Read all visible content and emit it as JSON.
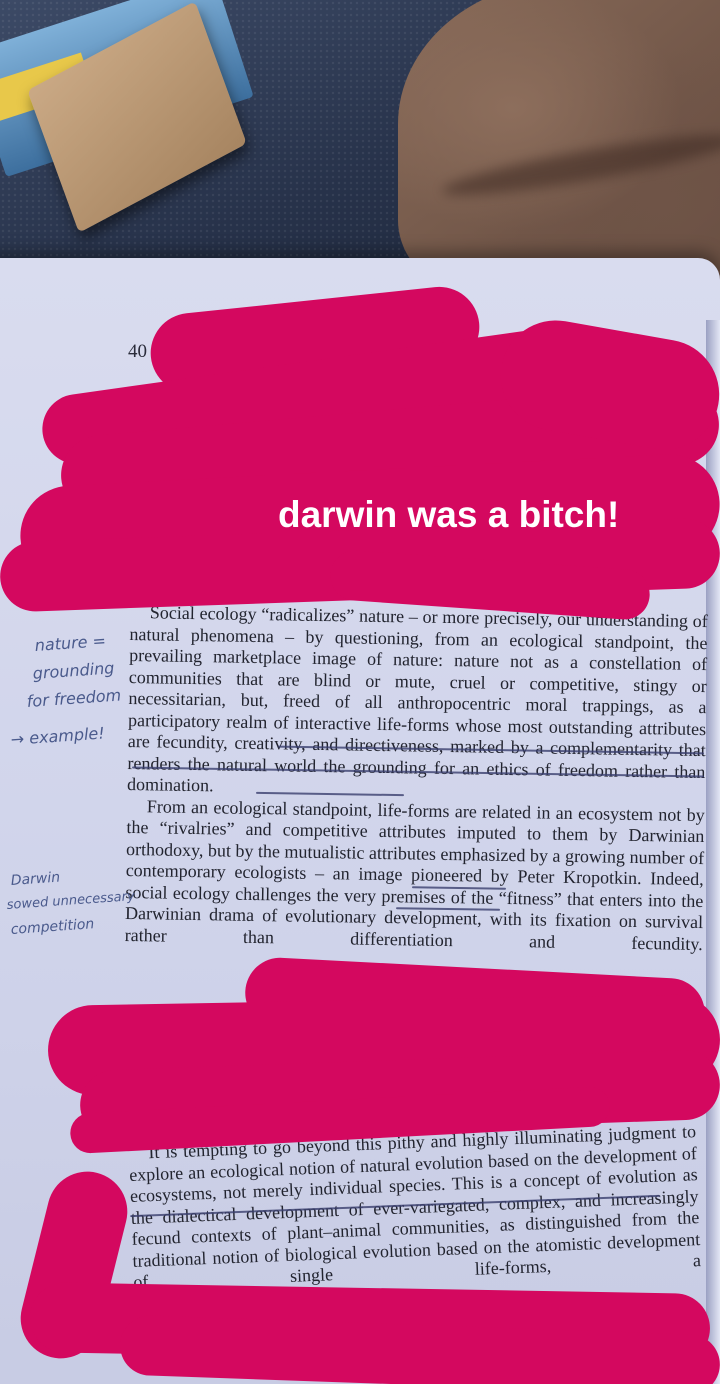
{
  "photo": {
    "sticker_caption": "darwin was a bitch!",
    "colors": {
      "redaction": "#d4085f",
      "page": "#d9dcef",
      "ink": "#22242f",
      "pencil": "#4a5a8c"
    }
  },
  "book": {
    "page_number": "40",
    "main_paragraphs": [
      "Social ecology “radicalizes” nature – or more precisely, our understanding of natural phenomena – by questioning, from an ecological standpoint, the prevailing marketplace image of nature: nature not as a constellation of communities that are blind or mute, cruel or competitive, stingy or necessitarian, but, freed of all anthropocentric moral trappings, as a participatory realm of interactive life-forms whose most outstanding attributes are fecundity, creativity, and directiveness, marked by a complementarity that renders the natural world the grounding for an ethics of freedom rather than domination.",
      "From an ecological standpoint, life-forms are related in an ecosystem not by the “rivalries” and competitive attributes imputed to them by Darwinian orthodoxy, but by the mutualistic attributes emphasized by a growing number of contemporary ecologists – an image pioneered by Peter Kropotkin. Indeed, social ecology challenges the very premises of the “fitness” that enters into the Darwinian drama of evolutionary development, with its fixation on survival rather than differentiation and fecundity."
    ],
    "lower_paragraph": "It is tempting to go beyond this pithy and highly illuminating judgment to explore an ecological notion of natural evolution based on the development of ecosystems, not merely individual species. This is a concept of evolution as the dialectical development of ever-variegated, complex, and increasingly fecund contexts of plant–animal communities, as distinguished from the traditional notion of biological evolution based on the atomistic development of single life-forms, a"
  },
  "margin_notes": {
    "note_1": "nature =",
    "note_2": "grounding",
    "note_3": "for freedom",
    "note_4": "→ example!",
    "note_5": "Darwin",
    "note_6": "sowed unnecessary",
    "note_7": "competition"
  }
}
